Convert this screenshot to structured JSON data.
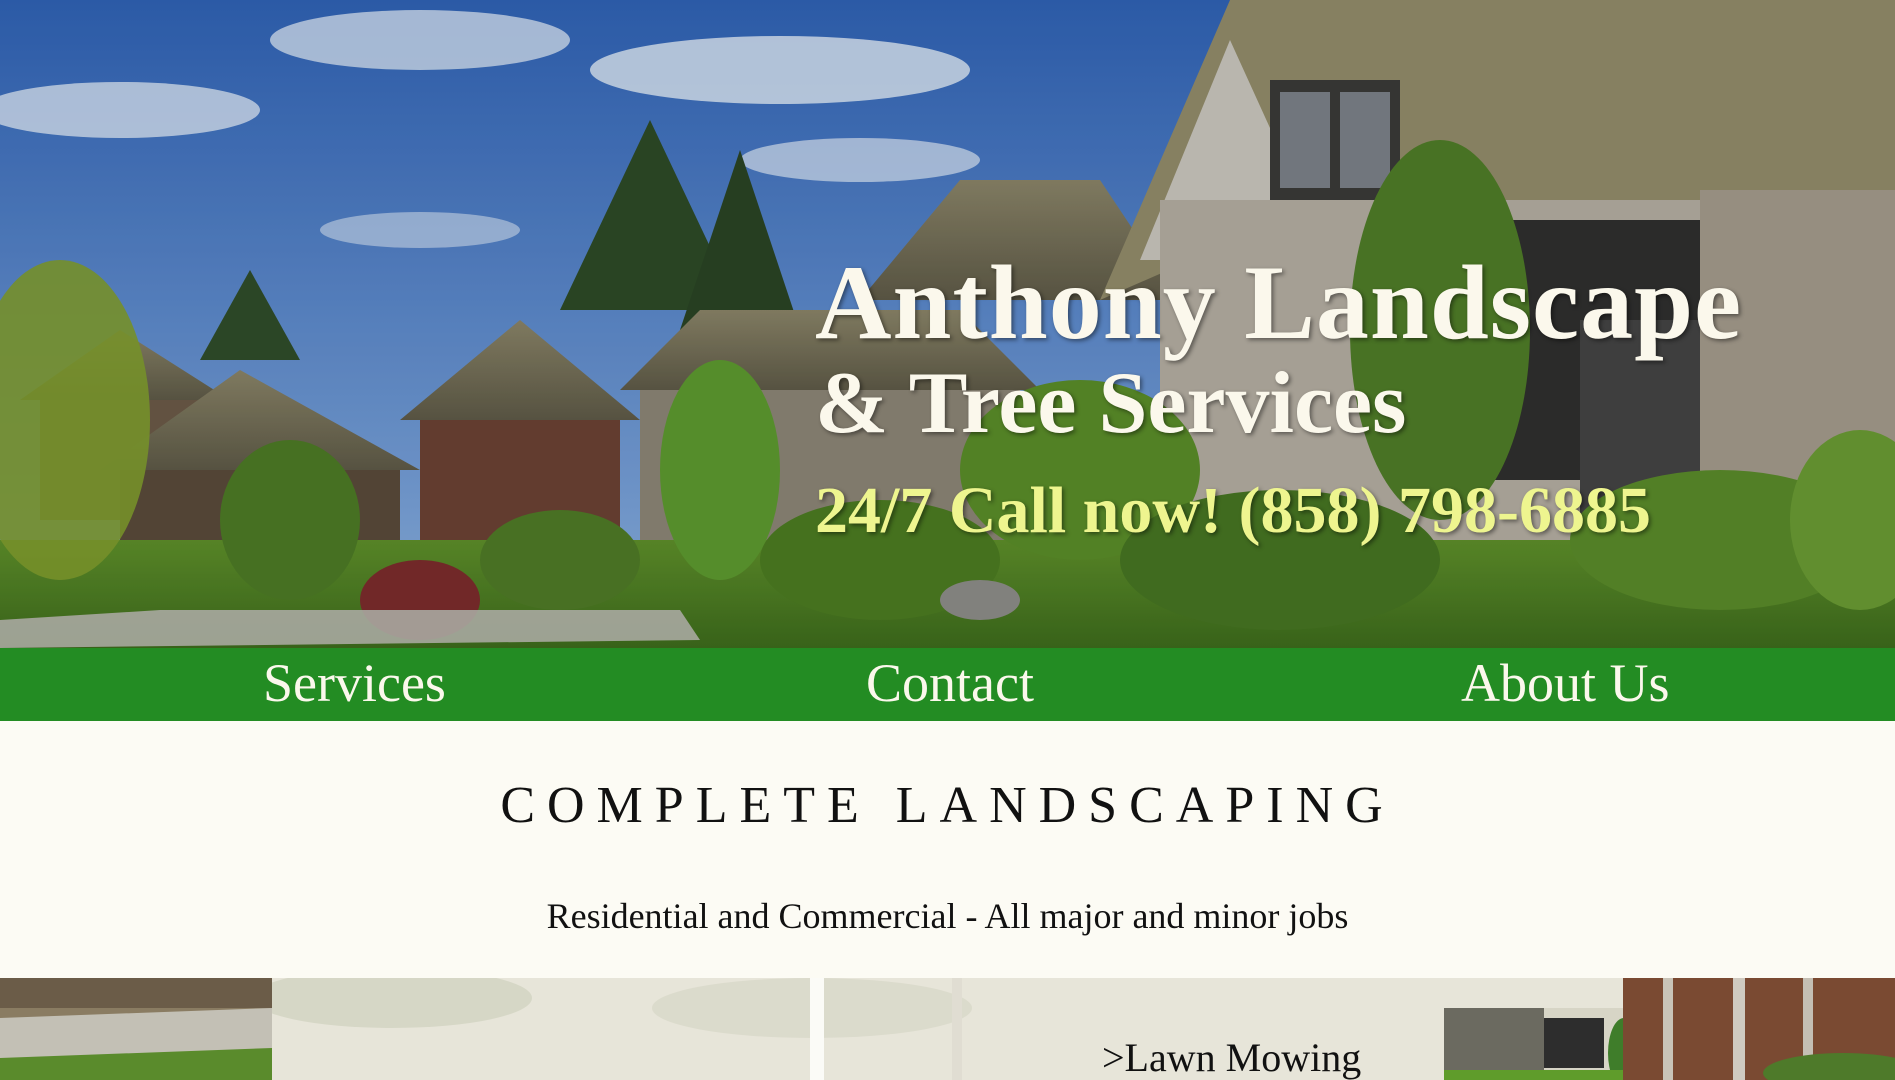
{
  "hero": {
    "title_line1": "Anthony Landscape",
    "title_line2": "& Tree Services",
    "phone_line": "24/7 Call now! (858) 798-6885",
    "background_image": "suburban houses with green landscaped front yards under blue sky"
  },
  "nav": {
    "items": [
      {
        "label": "Services"
      },
      {
        "label": "Contact"
      },
      {
        "label": "About Us"
      }
    ]
  },
  "main": {
    "heading": "COMPLETE LANDSCAPING",
    "subheading": "Residential and Commercial - All major and minor jobs"
  },
  "gallery": {
    "card_label": ">Lawn Mowing"
  },
  "colors": {
    "nav_bg": "#238c23",
    "page_bg": "#fcfbf4",
    "hero_text": "#fbf8ec",
    "phone_text": "#eef58f"
  }
}
